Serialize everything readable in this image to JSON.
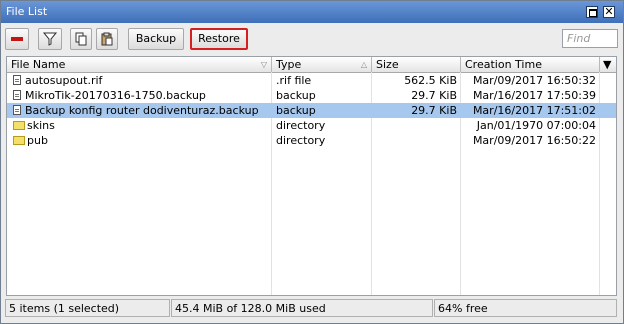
{
  "window": {
    "title": "File List"
  },
  "toolbar": {
    "backup_label": "Backup",
    "restore_label": "Restore",
    "find_placeholder": "Find"
  },
  "table": {
    "columns": [
      "File Name",
      "Type",
      "Size",
      "Creation Time"
    ],
    "rows": [
      {
        "name": "autosupout.rif",
        "type": ".rif file",
        "size": "562.5 KiB",
        "time": "Mar/09/2017 16:50:32",
        "icon": "file-icon"
      },
      {
        "name": "MikroTik-20170316-1750.backup",
        "type": "backup",
        "size": "29.7 KiB",
        "time": "Mar/16/2017 17:50:39",
        "icon": "file-icon"
      },
      {
        "name": "Backup konfig router dodiventuraz.backup",
        "type": "backup",
        "size": "29.7 KiB",
        "time": "Mar/16/2017 17:51:02",
        "icon": "file-icon",
        "selected": true
      },
      {
        "name": "skins",
        "type": "directory",
        "size": "",
        "time": "Jan/01/1970 07:00:04",
        "icon": "folder-icon"
      },
      {
        "name": "pub",
        "type": "directory",
        "size": "",
        "time": "Mar/09/2017 16:50:22",
        "icon": "folder-icon"
      }
    ]
  },
  "status": {
    "items": "5 items (1 selected)",
    "space": "45.4 MiB of 128.0 MiB used",
    "free": "64% free"
  },
  "colors": {
    "titlebar": "#4f7fc6",
    "selection": "#a6c8ef",
    "restore_outline": "#d42020"
  }
}
